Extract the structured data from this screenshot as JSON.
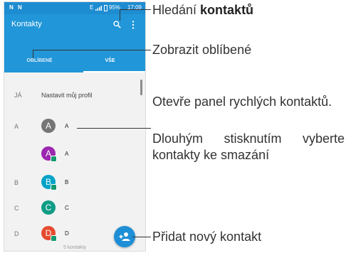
{
  "statusbar": {
    "left": "N N",
    "network": "E",
    "battery": "95%",
    "time": "17:09"
  },
  "appbar": {
    "title": "Kontakty",
    "icons": [
      "search-icon",
      "more-vert-icon"
    ]
  },
  "tabs": [
    {
      "label": "OBLÍBENÉ"
    },
    {
      "label": "VŠE",
      "selected": true
    }
  ],
  "profile": {
    "section": "JÁ",
    "label": "Nastavit můj profil"
  },
  "contacts": [
    {
      "section": "A",
      "initial": "A",
      "name": "A",
      "color": "#757575",
      "badge": false
    },
    {
      "section": "",
      "initial": "A",
      "name": "A",
      "color": "#9c27b0",
      "badge": true
    },
    {
      "section": "B",
      "initial": "B",
      "name": "B",
      "color": "#00a2c7",
      "badge": true
    },
    {
      "section": "C",
      "initial": "C",
      "name": "C",
      "color": "#0f9c85",
      "badge": false
    },
    {
      "section": "D",
      "initial": "D",
      "name": "D",
      "color": "#e64a2e",
      "badge": true
    }
  ],
  "footer": {
    "count": "5 kontakty"
  },
  "annotations": {
    "search_prefix": "Hledání ",
    "search_bold": "kontaktů",
    "favorites": "Zobrazit oblíbené",
    "quick_panel": "Otevře panel rychlých kontaktů.",
    "long_press": "Dlouhým stisknutím vyberte kontakty ke smazání",
    "add_contact": "Přidat nový kontakt"
  },
  "colors": {
    "accent": "#2196d8",
    "statusbar": "#1e8cd1",
    "fab": "#1e8fd6",
    "list_bg": "#f2f2f2"
  }
}
